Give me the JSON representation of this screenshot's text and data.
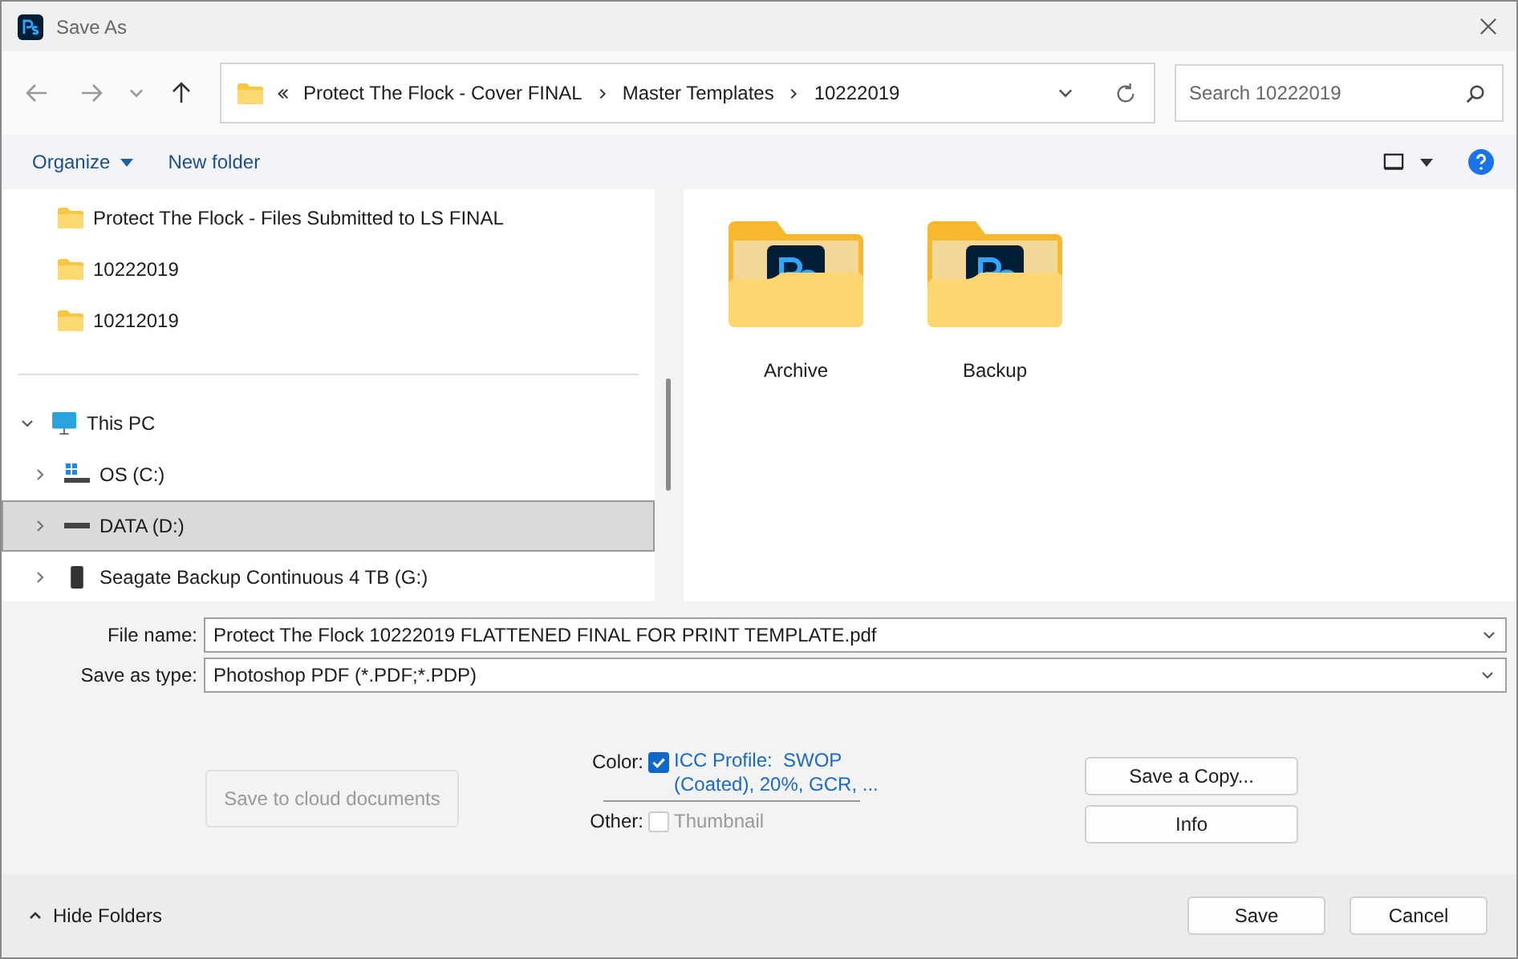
{
  "window": {
    "title": "Save As"
  },
  "address": {
    "crumbs": [
      "Protect The Flock - Cover FINAL",
      "Master Templates",
      "10222019"
    ]
  },
  "search": {
    "placeholder": "Search 10222019"
  },
  "toolbar": {
    "organize": "Organize",
    "new_folder": "New folder"
  },
  "nav_pane": {
    "items": [
      {
        "kind": "folder",
        "label": "Protect The Flock - Files Submitted to LS FINAL",
        "selected": false
      },
      {
        "kind": "folder",
        "label": "10222019",
        "selected": false
      },
      {
        "kind": "folder",
        "label": "10212019",
        "selected": false
      },
      {
        "kind": "pc",
        "label": "This PC",
        "selected": false,
        "expanded": true,
        "children": [
          {
            "kind": "os_drive",
            "label": "OS (C:)",
            "selected": false,
            "expanded": false
          },
          {
            "kind": "drive",
            "label": "DATA (D:)",
            "selected": true,
            "expanded": false
          },
          {
            "kind": "external_drive",
            "label": "Seagate Backup Continuous 4 TB (G:)",
            "selected": false,
            "expanded": false
          }
        ]
      }
    ]
  },
  "files": [
    {
      "label": "Archive"
    },
    {
      "label": "Backup"
    }
  ],
  "form": {
    "file_name_label": "File name:",
    "file_name": "Protect The Flock 10222019 FLATTENED FINAL FOR PRINT TEMPLATE.pdf",
    "type_label": "Save as type:",
    "type": "Photoshop PDF (*.PDF;*.PDP)"
  },
  "options": {
    "cloud_button": {
      "label": "Save to cloud documents",
      "disabled": true
    },
    "color": {
      "label": "Color:",
      "option": "ICC Profile:  SWOP (Coated), 20%, GCR, ...",
      "checked": true,
      "disabled": false
    },
    "other": {
      "label": "Other:",
      "option": "Thumbnail",
      "checked": false,
      "disabled": true
    },
    "buttons": [
      "Save a Copy...",
      "Info"
    ]
  },
  "footer": {
    "hide_folders": "Hide Folders",
    "buttons": [
      "Save",
      "Cancel"
    ]
  }
}
